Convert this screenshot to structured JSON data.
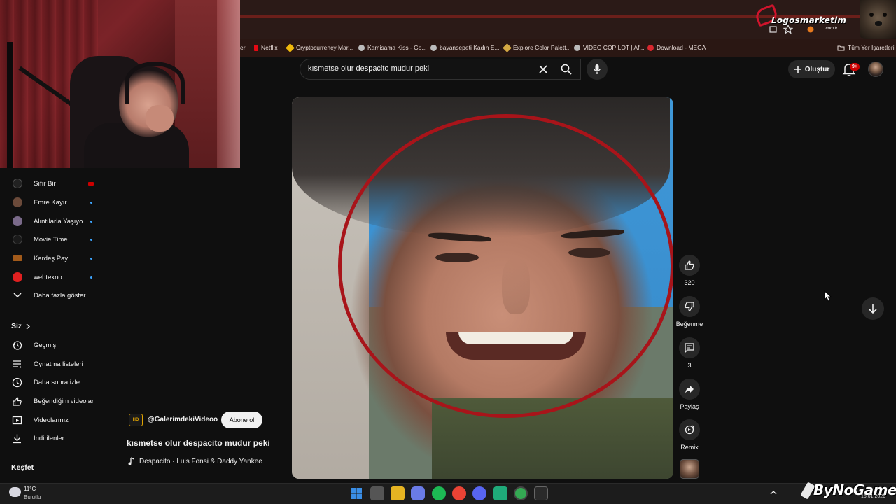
{
  "browser": {
    "overlay_logo": {
      "brand": "Logosmarketim",
      "sub": ".com.tr"
    },
    "bookmarks": [
      {
        "label": "er",
        "icon": "bookmark-cut-icon",
        "color": "#888888"
      },
      {
        "label": "Netflix",
        "icon": "netflix-icon",
        "color": "#e50914"
      },
      {
        "label": "Cryptocurrency Mar...",
        "icon": "binance-icon",
        "color": "#f0b90b"
      },
      {
        "label": "Kamisama Kiss - Go...",
        "icon": "globe-icon",
        "color": "#bbbbbb"
      },
      {
        "label": "bayansepeti Kadın E...",
        "icon": "globe-icon",
        "color": "#bbbbbb"
      },
      {
        "label": "Explore Color Palett...",
        "icon": "palette-icon",
        "color": "#d4a843"
      },
      {
        "label": "VIDEO COPILOT | Af...",
        "icon": "globe-icon",
        "color": "#bbbbbb"
      },
      {
        "label": "Download - MEGA",
        "icon": "mega-icon",
        "color": "#d9272e"
      }
    ],
    "all_bookmarks": "Tüm Yer İşaretleri"
  },
  "youtube": {
    "search": {
      "query": "kısmetse olur despacito mudur peki"
    },
    "create_label": "Oluştur",
    "notifications_badge": "9+"
  },
  "sidebar": {
    "subscriptions": [
      {
        "label": "Sıfır Bir",
        "indicator": "live",
        "avatar_color": "#222222"
      },
      {
        "label": "Emre Kayır",
        "indicator": "dot",
        "avatar_color": "#6b4a3a"
      },
      {
        "label": "Alıntılarla Yaşıyo...",
        "indicator": "dot",
        "avatar_color": "#7a6a8a"
      },
      {
        "label": "Movie Time",
        "indicator": "dot",
        "avatar_color": "#1a1a1a"
      },
      {
        "label": "Kardeş Payı",
        "indicator": "dot",
        "avatar_color": "#a25a1a"
      },
      {
        "label": "webtekno",
        "indicator": "dot",
        "avatar_color": "#e02020"
      }
    ],
    "show_more": "Daha fazla göster",
    "you_heading": "Siz",
    "you_items": [
      {
        "label": "Geçmiş",
        "icon": "history-icon"
      },
      {
        "label": "Oynatma listeleri",
        "icon": "playlists-icon"
      },
      {
        "label": "Daha sonra izle",
        "icon": "watch-later-icon"
      },
      {
        "label": "Beğendiğim videolar",
        "icon": "liked-videos-icon"
      },
      {
        "label": "Videolarınız",
        "icon": "your-videos-icon"
      },
      {
        "label": "İndirilenler",
        "icon": "downloads-icon"
      }
    ],
    "explore_heading": "Keşfet"
  },
  "short": {
    "channel_logo_text": "HD",
    "channel_handle": "@GalerimdekiVideoo",
    "subscribe_label": "Abone ol",
    "title": "kısmetse olur despacito mudur peki",
    "music": "Despacito · Luis Fonsi & Daddy Yankee"
  },
  "actions": {
    "like_count": "320",
    "dislike_label": "Beğenme",
    "comment_count": "3",
    "share_label": "Paylaş",
    "remix_label": "Remix"
  },
  "taskbar": {
    "weather_temp": "11°C",
    "weather_cond": "Bulutlu",
    "apps": [
      {
        "name": "windows-start-icon",
        "color": "#3a8ee6"
      },
      {
        "name": "task-view-icon",
        "color": "#555555"
      },
      {
        "name": "file-explorer-icon",
        "color": "#e6b422"
      },
      {
        "name": "copilot-icon",
        "color": "#6a7be6"
      },
      {
        "name": "spotify-icon",
        "color": "#1db954"
      },
      {
        "name": "chrome-icon",
        "color": "#ea4335"
      },
      {
        "name": "discord-icon",
        "color": "#5865f2"
      },
      {
        "name": "app-green-icon",
        "color": "#1faa7a"
      },
      {
        "name": "chrome-active-icon",
        "color": "#34a853"
      },
      {
        "name": "epic-games-icon",
        "color": "#2a2a2a"
      }
    ],
    "watermark": "ByNoGame",
    "date": "15.01.2026"
  }
}
